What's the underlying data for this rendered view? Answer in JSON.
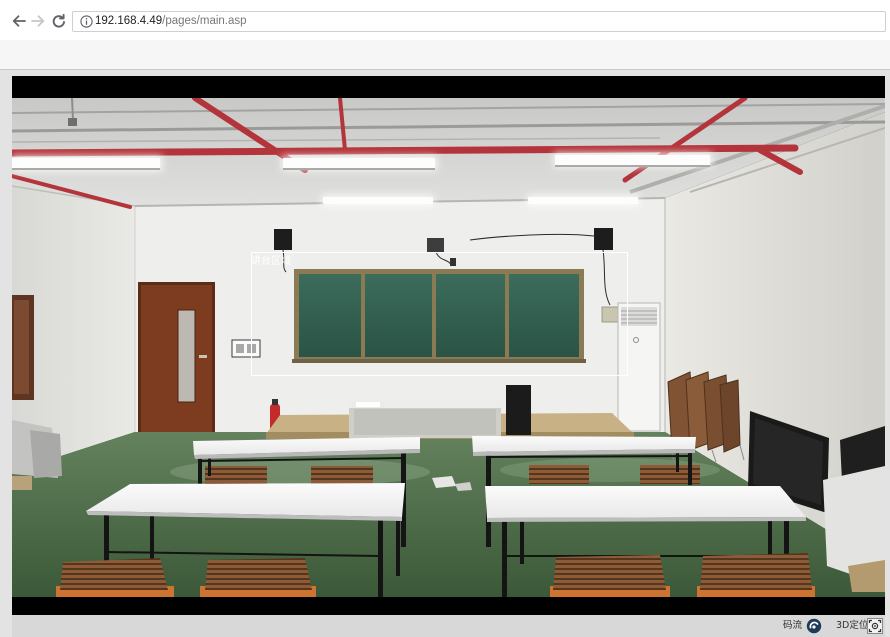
{
  "browser": {
    "back_icon": "arrow-left-icon",
    "forward_icon": "arrow-right-icon",
    "reload_icon": "reload-icon",
    "site_info_icon": "info-icon",
    "url_host": "192.168.4.49",
    "url_path": "/pages/main.asp"
  },
  "live_view": {
    "region_label": "讲台区域",
    "region_outline_color": "#ffffff",
    "letterbox_color": "#000000"
  },
  "toolbar": {
    "stream_label": "码流",
    "stream_icon": "stream-icon",
    "position_label": "3D定位",
    "position_icon": "3d-position-icon"
  }
}
